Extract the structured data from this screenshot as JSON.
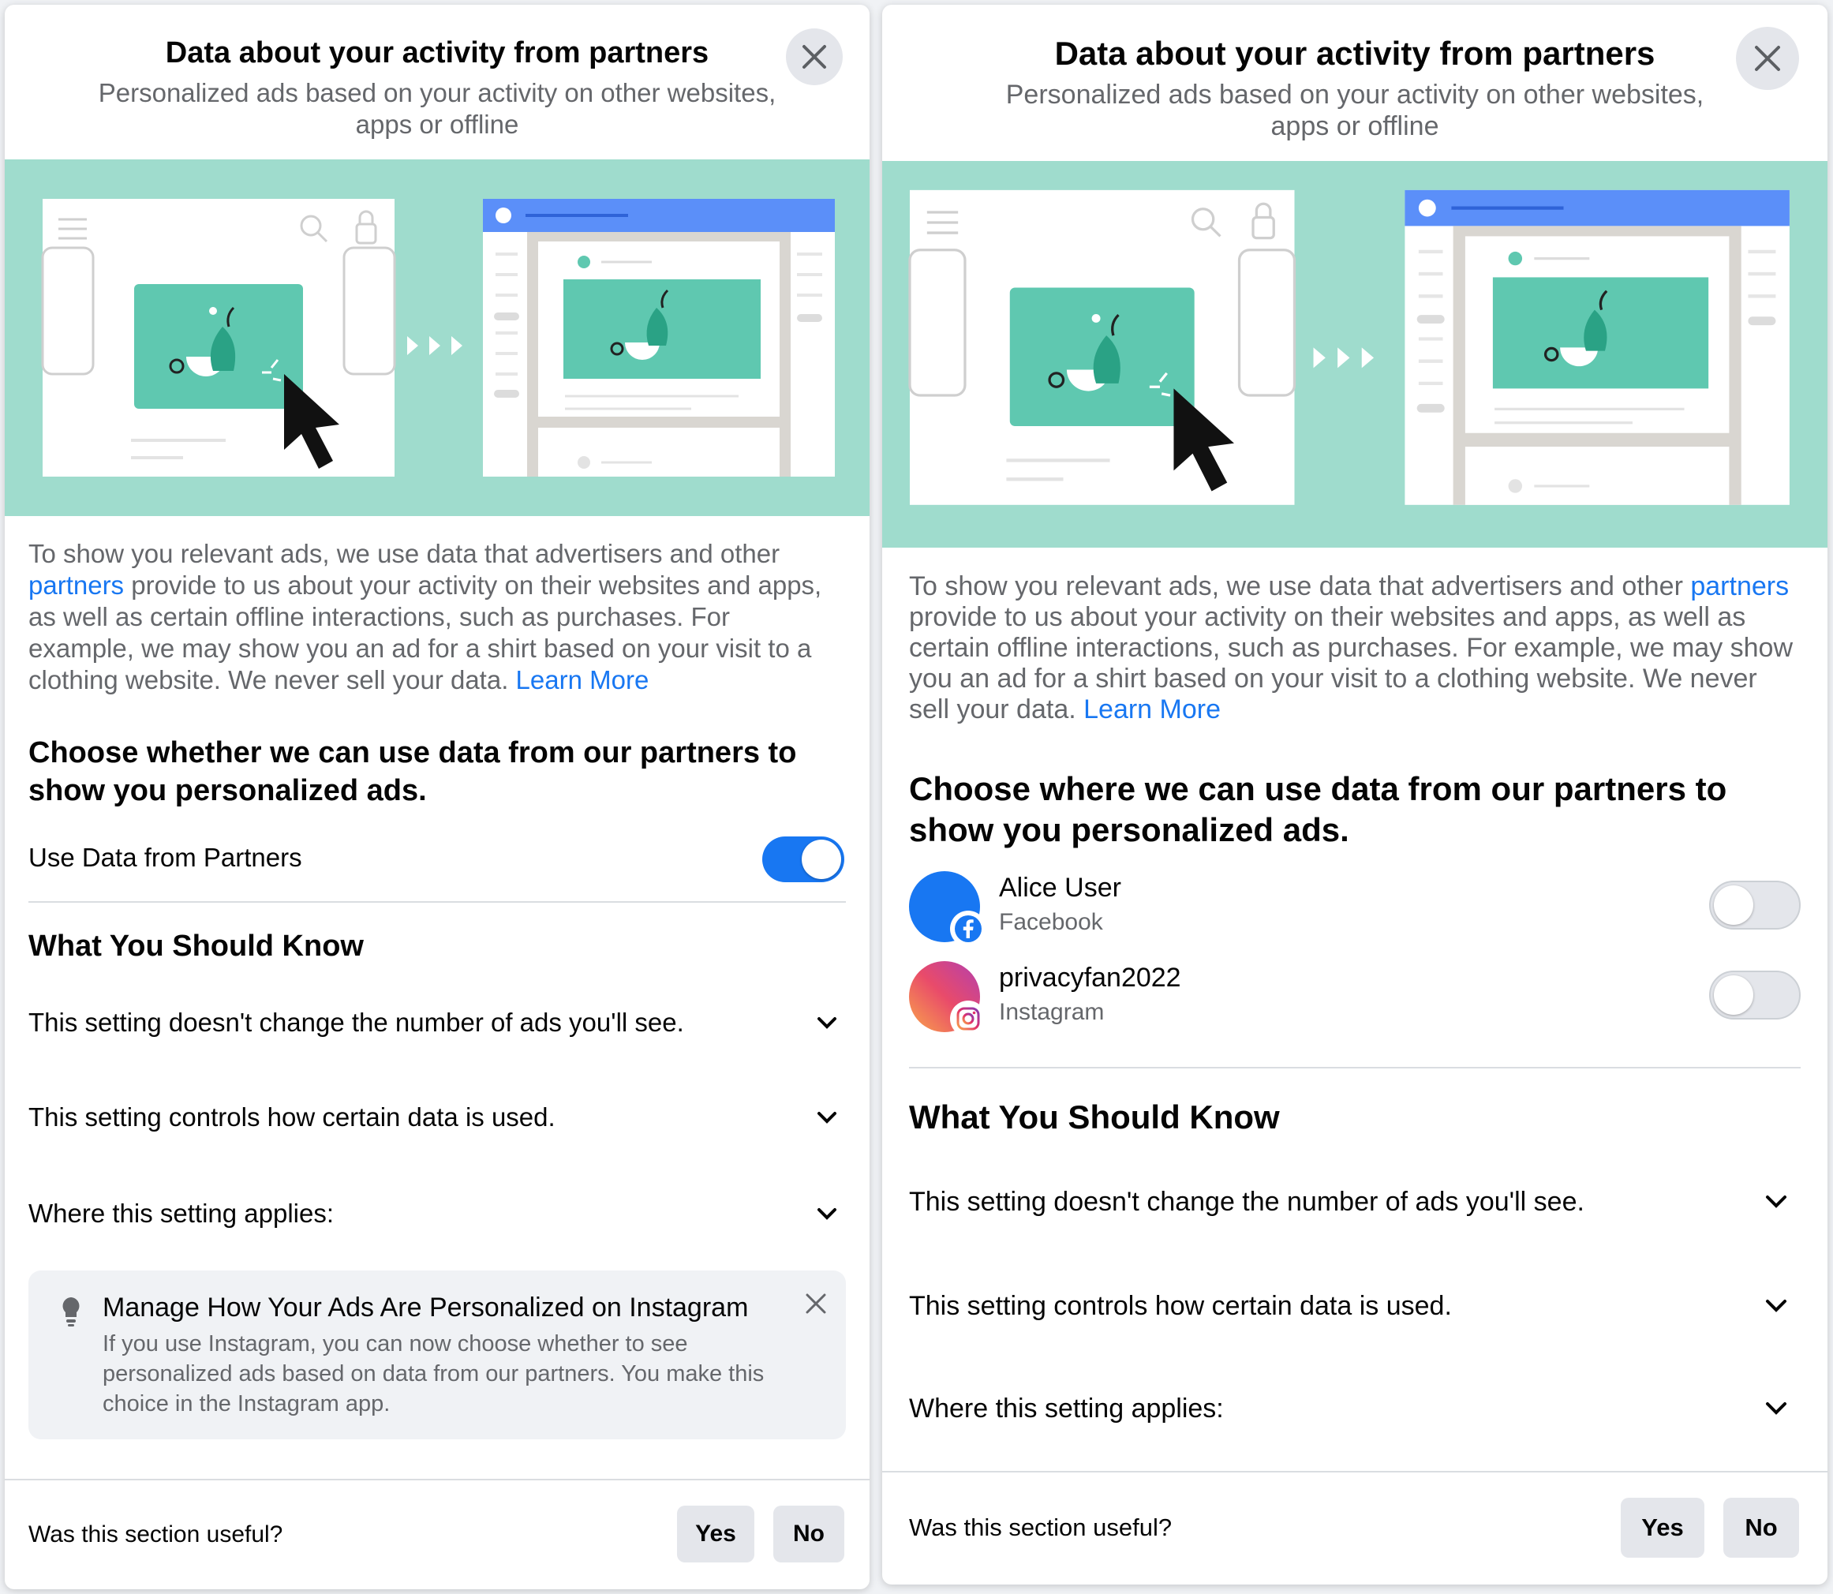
{
  "left_panel": {
    "header": {
      "title": "Data about your activity from partners",
      "subtitle_line1": "Personalized ads based on your activity on other websites,",
      "subtitle_line2": "apps or offline"
    },
    "body": {
      "text_before_link": "To show you relevant ads, we use data that advertisers and other ",
      "partners_link": "partners",
      "text_after_link": " provide to us about your activity on their websites and apps, as well as certain offline interactions, such as purchases. For example, we may show you an ad for a shirt based on your visit to a clothing website. We never sell your data. ",
      "learn_more_link": "Learn More"
    },
    "choose_heading": "Choose whether we can use data from our partners to show you personalized ads.",
    "toggle": {
      "label": "Use Data from Partners",
      "state": "on"
    },
    "know_heading": "What You Should Know",
    "accordion": [
      "This setting doesn't change the number of ads you'll see.",
      "This setting controls how certain data is used.",
      "Where this setting applies:"
    ],
    "tip": {
      "icon": "lightbulb-icon",
      "title": "Manage How Your Ads Are Personalized on Instagram",
      "body": "If you use Instagram, you can now choose whether to see personalized ads based on data from our partners. You make this choice in the Instagram app."
    },
    "footer": {
      "question": "Was this section useful?",
      "yes": "Yes",
      "no": "No"
    }
  },
  "right_panel": {
    "header": {
      "title": "Data about your activity from partners",
      "subtitle_line1": "Personalized ads based on your activity on other websites,",
      "subtitle_line2": "apps or offline"
    },
    "body": {
      "text_before_link": "To show you relevant ads, we use data that advertisers and other ",
      "partners_link": "partners",
      "text_after_link": " provide to us about your activity on their websites and apps, as well as certain offline interactions, such as purchases. For example, we may show you an ad for a shirt based on your visit to a clothing website. We never sell your data. ",
      "learn_more_link": "Learn More"
    },
    "choose_heading": "Choose where we can use data from our partners to show you personalized ads.",
    "accounts": [
      {
        "name": "Alice User",
        "platform": "Facebook",
        "badge_icon": "facebook-icon",
        "state": "off"
      },
      {
        "name": "privacyfan2022",
        "platform": "Instagram",
        "badge_icon": "instagram-icon",
        "state": "off"
      }
    ],
    "know_heading": "What You Should Know",
    "accordion": [
      "This setting doesn't change the number of ads you'll see.",
      "This setting controls how certain data is used.",
      "Where this setting applies:"
    ],
    "footer": {
      "question": "Was this section useful?",
      "yes": "Yes",
      "no": "No"
    }
  },
  "colors": {
    "accent_blue": "#1877f2",
    "banner_green": "#9fdccd",
    "illustration_teal": "#5fc8b0",
    "secondary_text": "#65676b",
    "button_gray": "#e4e6eb"
  }
}
